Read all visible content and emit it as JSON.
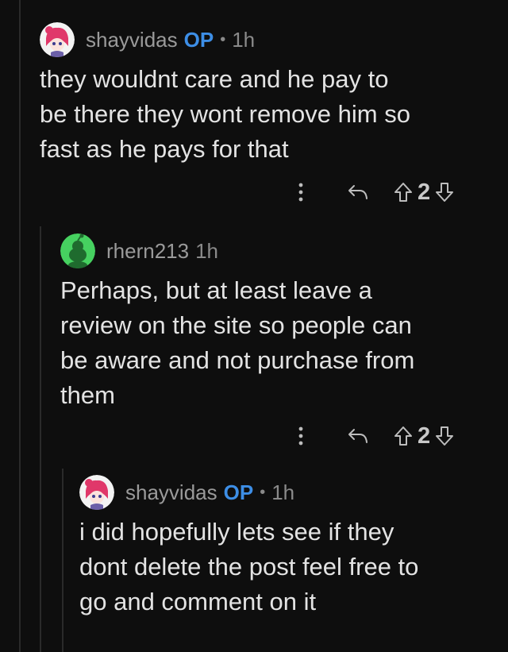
{
  "comments": [
    {
      "username": "shayvidas",
      "op_label": "OP",
      "separator": "•",
      "time": "1h",
      "lines": [
        "they wouldnt care and he pay to",
        "be there they wont remove him so",
        "fast as he pays for that"
      ],
      "votes": "2"
    },
    {
      "username": "rhern213",
      "time": "1h",
      "lines": [
        "Perhaps, but at least leave a",
        "review on the site so people can",
        "be aware and not purchase from",
        "them"
      ],
      "votes": "2"
    },
    {
      "username": "shayvidas",
      "op_label": "OP",
      "separator": "•",
      "time": "1h",
      "lines": [
        "i did hopefully lets see if they",
        "dont delete the post feel free to",
        "go and comment on it"
      ]
    }
  ],
  "colors": {
    "background": "#0e0e0e",
    "op_blue": "#3d8ee6",
    "snoo_green": "#46d160"
  },
  "icons": {
    "more": "more-vertical-icon",
    "reply": "reply-icon",
    "upvote": "upvote-arrow-icon",
    "downvote": "downvote-arrow-icon"
  }
}
